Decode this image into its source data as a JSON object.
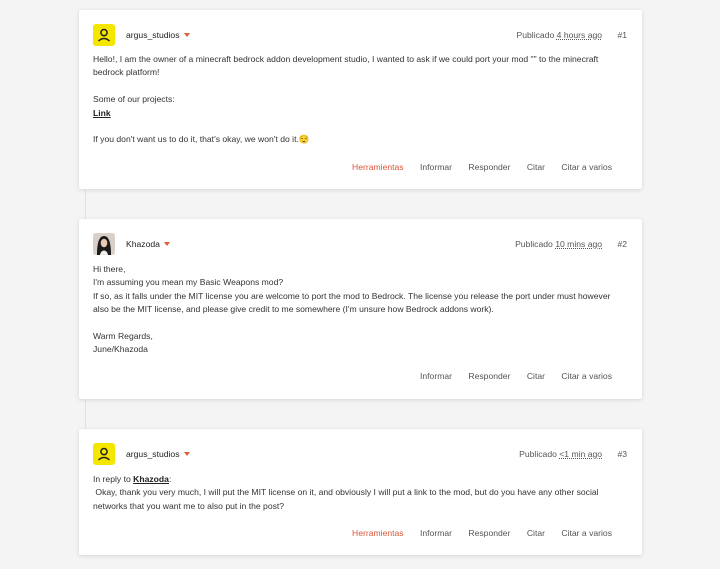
{
  "posts": [
    {
      "author": "argus_studios",
      "posted_prefix": "Publicado",
      "time": "4 hours ago",
      "number": "#1",
      "lines": [
        "Hello!, I am the owner of a minecraft bedrock addon development studio, I wanted to ask if we could port your mod \"\" to the minecraft",
        "bedrock platform!",
        "Some of our projects:",
        "If you don't want us to do it, that's okay, we won't do it.😌"
      ],
      "link_text": "Link",
      "actions": {
        "tools": "Herramientas",
        "report": "Informar",
        "reply": "Responder",
        "quote": "Citar",
        "multiquote": "Citar a varios"
      }
    },
    {
      "author": "Khazoda",
      "posted_prefix": "Publicado",
      "time": "10 mins ago",
      "number": "#2",
      "lines": [
        "Hi there,",
        "I'm assuming you mean my Basic Weapons mod?",
        "If so, as it falls under the MIT license you are welcome to port the mod to Bedrock. The license you release the port under must however",
        "also be the MIT license, and please give credit to me somewhere (I'm unsure how Bedrock addons work).",
        "Warm Regards,",
        "June/Khazoda"
      ],
      "actions": {
        "report": "Informar",
        "reply": "Responder",
        "quote": "Citar",
        "multiquote": "Citar a varios"
      }
    },
    {
      "author": "argus_studios",
      "posted_prefix": "Publicado",
      "time": "<1 min ago",
      "number": "#3",
      "reply_prefix": "In reply to",
      "reply_to": "Khazoda",
      "reply_suffix": ":",
      "lines": [
        " Okay, thank you very much, I will put the MIT license on it, and obviously I will put a link to the mod, but do you have any other social",
        "networks that you want me to also put in the post?"
      ],
      "actions": {
        "tools": "Herramientas",
        "report": "Informar",
        "reply": "Responder",
        "quote": "Citar",
        "multiquote": "Citar a varios"
      }
    }
  ],
  "icons": {
    "default_avatar": "user-silhouette-icon",
    "author_menu": "caret-down-icon"
  },
  "colors": {
    "accent": "#e05c3a",
    "default_avatar_bg": "#f5e600",
    "page_bg": "#f4f4f4"
  }
}
